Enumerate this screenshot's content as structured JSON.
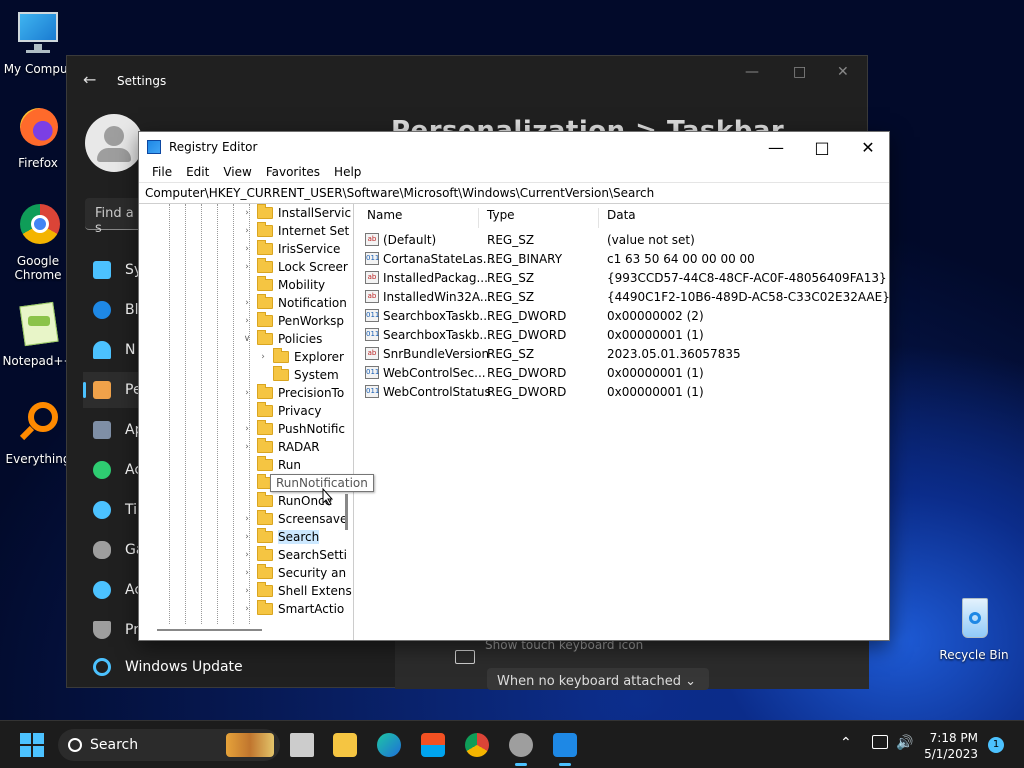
{
  "desktop": {
    "icons": [
      {
        "label": "My Comput"
      },
      {
        "label": "Firefox"
      },
      {
        "label": "Google Chrome"
      },
      {
        "label": "Notepad++"
      },
      {
        "label": "Everything"
      },
      {
        "label": "Recycle Bin"
      }
    ]
  },
  "settings": {
    "title": "Settings",
    "heading": "Personalization  >  Taskbar",
    "find_placeholder": "Find a s",
    "nav": [
      "Sy",
      "Bl",
      "N",
      "Pe",
      "Ap",
      "Ac",
      "Ti",
      "Ga",
      "Ac",
      "Pr"
    ],
    "windows_update": "Windows Update",
    "keyboard_row_label": "Show touch keyboard icon",
    "keyboard_select_value": "When no keyboard attached"
  },
  "regedit": {
    "title": "Registry Editor",
    "menu": [
      "File",
      "Edit",
      "View",
      "Favorites",
      "Help"
    ],
    "address": "Computer\\HKEY_CURRENT_USER\\Software\\Microsoft\\Windows\\CurrentVersion\\Search",
    "tree": [
      {
        "label": "InstallServic",
        "expandable": true
      },
      {
        "label": "Internet Set",
        "expandable": true
      },
      {
        "label": "IrisService",
        "expandable": true
      },
      {
        "label": "Lock Screer",
        "expandable": true
      },
      {
        "label": "Mobility",
        "expandable": false
      },
      {
        "label": "Notification",
        "expandable": true
      },
      {
        "label": "PenWorksp",
        "expandable": true
      },
      {
        "label": "Policies",
        "expandable": true,
        "expanded": true
      },
      {
        "label": "Explorer",
        "expandable": true,
        "child": true
      },
      {
        "label": "System",
        "expandable": false,
        "child": true
      },
      {
        "label": "PrecisionTo",
        "expandable": true
      },
      {
        "label": "Privacy",
        "expandable": false
      },
      {
        "label": "PushNotific",
        "expandable": true
      },
      {
        "label": "RADAR",
        "expandable": true
      },
      {
        "label": "Run",
        "expandable": false
      },
      {
        "label": "RunNotification",
        "expandable": false
      },
      {
        "label": "RunOnce",
        "expandable": false
      },
      {
        "label": "Screensave",
        "expandable": true
      },
      {
        "label": "Search",
        "expandable": true,
        "selected": true
      },
      {
        "label": "SearchSetti",
        "expandable": true
      },
      {
        "label": "Security an",
        "expandable": true
      },
      {
        "label": "Shell Extens",
        "expandable": true
      },
      {
        "label": "SmartActio",
        "expandable": true
      }
    ],
    "tooltip": "RunNotification",
    "columns": [
      "Name",
      "Type",
      "Data"
    ],
    "values": [
      {
        "icon": "ab",
        "name": "(Default)",
        "type": "REG_SZ",
        "data": "(value not set)"
      },
      {
        "icon": "bin",
        "name": "CortanaStateLas...",
        "type": "REG_BINARY",
        "data": "c1 63 50 64 00 00 00 00"
      },
      {
        "icon": "ab",
        "name": "InstalledPackag...",
        "type": "REG_SZ",
        "data": "{993CCD57-44C8-48CF-AC0F-48056409FA13}"
      },
      {
        "icon": "ab",
        "name": "InstalledWin32A...",
        "type": "REG_SZ",
        "data": "{4490C1F2-10B6-489D-AC58-C33C02E32AAE}"
      },
      {
        "icon": "bin",
        "name": "SearchboxTaskb...",
        "type": "REG_DWORD",
        "data": "0x00000002 (2)"
      },
      {
        "icon": "bin",
        "name": "SearchboxTaskb...",
        "type": "REG_DWORD",
        "data": "0x00000001 (1)"
      },
      {
        "icon": "ab",
        "name": "SnrBundleVersion",
        "type": "REG_SZ",
        "data": "2023.05.01.36057835"
      },
      {
        "icon": "bin",
        "name": "WebControlSec...",
        "type": "REG_DWORD",
        "data": "0x00000001 (1)"
      },
      {
        "icon": "bin",
        "name": "WebControlStatus",
        "type": "REG_DWORD",
        "data": "0x00000001 (1)"
      }
    ]
  },
  "taskbar": {
    "search_label": "Search",
    "time": "7:18 PM",
    "date": "5/1/2023",
    "notification_count": "1"
  }
}
